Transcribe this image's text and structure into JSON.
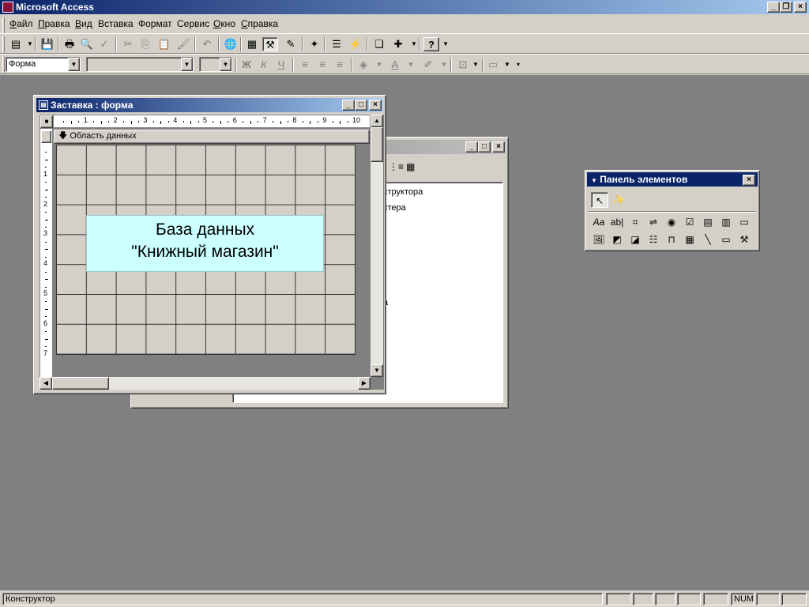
{
  "app": {
    "title": "Microsoft Access"
  },
  "menu": {
    "items": [
      {
        "label": "Файл",
        "accel": "Ф",
        "rest": "айл"
      },
      {
        "label": "Правка",
        "accel": "П",
        "rest": "равка"
      },
      {
        "label": "Вид",
        "accel": "В",
        "rest": "ид"
      },
      {
        "label": "Вставка",
        "accel": "",
        "rest": "Вставка"
      },
      {
        "label": "Формат",
        "accel": "",
        "rest": "Формат"
      },
      {
        "label": "Сервис",
        "accel": "",
        "rest": "Сервис"
      },
      {
        "label": "Окно",
        "accel": "О",
        "rest": "кно"
      },
      {
        "label": "Справка",
        "accel": "С",
        "rest": "правка"
      }
    ]
  },
  "format_toolbar": {
    "object_combo": "Форма",
    "bold": "Ж",
    "italic": "К",
    "underline": "Ч"
  },
  "form_window": {
    "title": "Заставка : форма",
    "section_label": "Область данных",
    "ruler_numbers": [
      "1",
      "2",
      "3",
      "4",
      "5",
      "6",
      "7",
      "8",
      "9",
      "10"
    ],
    "vruler_numbers": [
      "1",
      "2",
      "3",
      "4",
      "5",
      "6",
      "7"
    ],
    "label_line1": "База данных",
    "label_line2": "\"Книжный магазин\""
  },
  "db_window": {
    "item1": "структора",
    "item2": "стера",
    "item3": "а"
  },
  "toolbox": {
    "title": "Панель элементов"
  },
  "status": {
    "mode": "Конструктор",
    "num": "NUM"
  },
  "colors": {
    "title_active": "#0a246a",
    "label_bg": "#ccffff",
    "workspace": "#808080"
  }
}
